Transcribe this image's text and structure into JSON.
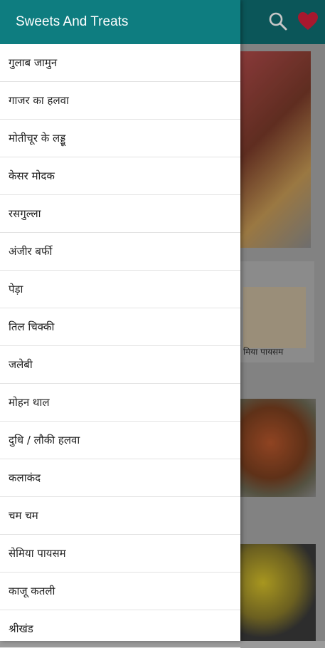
{
  "drawer": {
    "title": "Sweets And Treats",
    "items": [
      {
        "label": "गुलाब जामुन"
      },
      {
        "label": "गाजर का हलवा"
      },
      {
        "label": "मोतीचूर के लड्डू"
      },
      {
        "label": "केसर मोदक"
      },
      {
        "label": "रसगुल्ला"
      },
      {
        "label": "अंजीर बर्फी"
      },
      {
        "label": "पेड़ा"
      },
      {
        "label": "तिल चिक्की"
      },
      {
        "label": "जलेबी"
      },
      {
        "label": "मोहन थाल"
      },
      {
        "label": "दुधि / लौकी हलवा"
      },
      {
        "label": "कलाकंद"
      },
      {
        "label": "चम चम"
      },
      {
        "label": "सेमिया पायसम"
      },
      {
        "label": "काजू कतली"
      },
      {
        "label": "श्रीखंड"
      }
    ]
  },
  "appbar": {
    "icons": [
      "search-icon",
      "heart-icon"
    ]
  },
  "cards": {
    "partial_caption": "मिया पायसम"
  },
  "colors": {
    "header": "#0e7d80",
    "heart": "#d61f3c"
  }
}
